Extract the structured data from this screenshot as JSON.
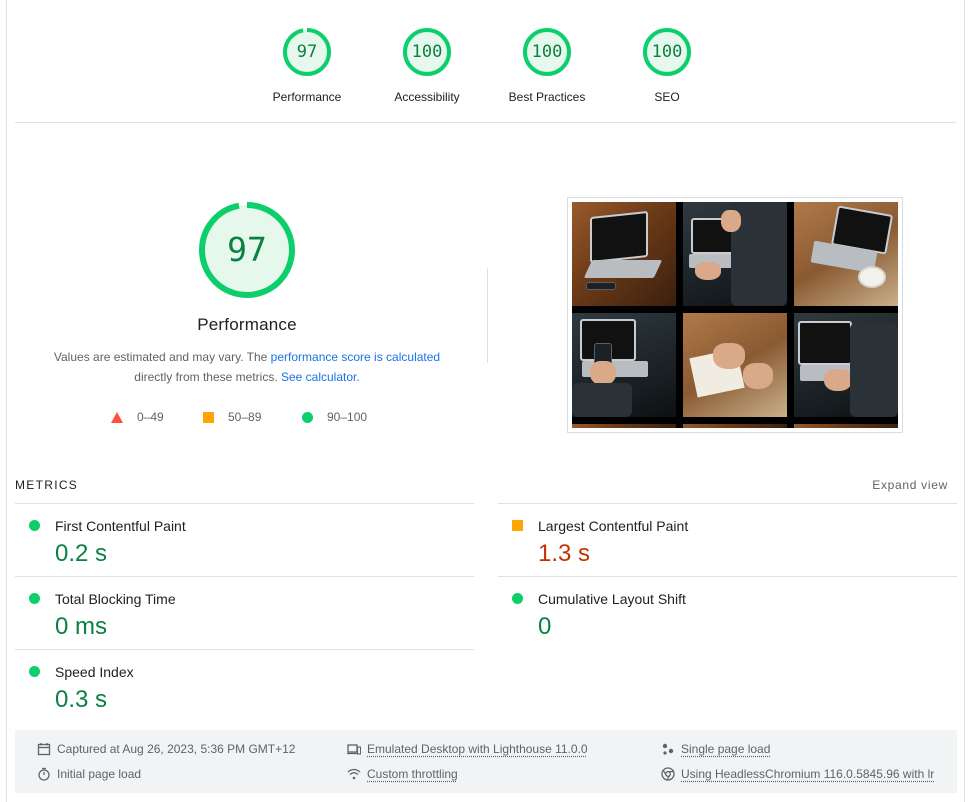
{
  "gauges": [
    {
      "score": "97",
      "label": "Performance",
      "fraction": 0.97
    },
    {
      "score": "100",
      "label": "Accessibility",
      "fraction": 1.0
    },
    {
      "score": "100",
      "label": "Best Practices",
      "fraction": 1.0
    },
    {
      "score": "100",
      "label": "SEO",
      "fraction": 1.0
    }
  ],
  "performance": {
    "score": "97",
    "fraction": 0.97,
    "title": "Performance",
    "desc_part1": "Values are estimated and may vary. The ",
    "desc_link1": "performance score is calculated",
    "desc_part2": "directly from these metrics. ",
    "desc_link2": "See calculator."
  },
  "legend": {
    "fail": "0–49",
    "average": "50–89",
    "pass": "90–100"
  },
  "metrics": {
    "heading": "METRICS",
    "expand_label": "Expand view",
    "items": [
      {
        "label": "First Contentful Paint",
        "value": "0.2 s",
        "rating": "pass"
      },
      {
        "label": "Largest Contentful Paint",
        "value": "1.3 s",
        "rating": "average"
      },
      {
        "label": "Total Blocking Time",
        "value": "0 ms",
        "rating": "pass"
      },
      {
        "label": "Cumulative Layout Shift",
        "value": "0",
        "rating": "pass"
      },
      {
        "label": "Speed Index",
        "value": "0.3 s",
        "rating": "pass"
      }
    ]
  },
  "footer": {
    "captured": "Captured at Aug 26, 2023, 5:36 PM GMT+12",
    "initial_load": "Initial page load",
    "emulated": "Emulated Desktop with Lighthouse 11.0.0",
    "throttling": "Custom throttling",
    "single_load": "Single page load",
    "using": "Using HeadlessChromium 116.0.5845.96 with lr"
  },
  "colors": {
    "pass": "#0cce6b",
    "pass_text": "#0b8043",
    "average": "#ffa400",
    "average_text": "#c33300",
    "fail": "#ff4e42",
    "link": "#1a73e8"
  }
}
